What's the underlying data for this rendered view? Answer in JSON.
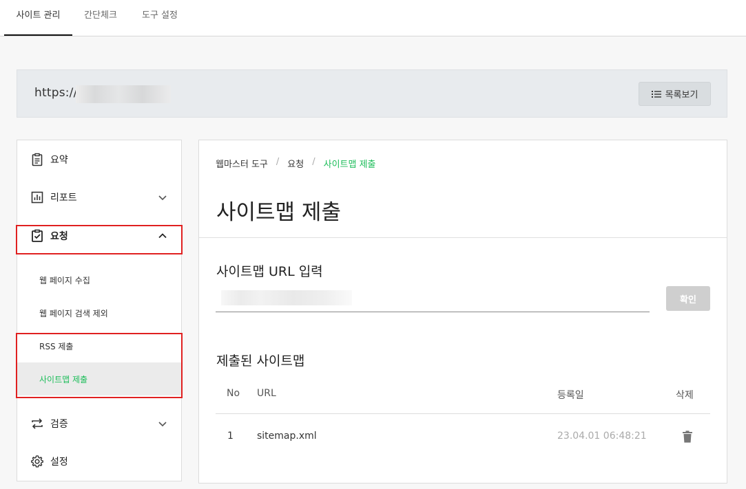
{
  "tabs": [
    {
      "label": "사이트 관리",
      "active": true
    },
    {
      "label": "간단체크",
      "active": false
    },
    {
      "label": "도구 설정",
      "active": false
    }
  ],
  "site": {
    "url_prefix": "https://",
    "list_button": "목록보기"
  },
  "sidebar": {
    "summary": "요약",
    "report": "리포트",
    "request": "요청",
    "request_sub": [
      "웹 페이지 수집",
      "웹 페이지 검색 제외",
      "RSS 제출",
      "사이트맵 제출"
    ],
    "verify": "검증",
    "settings": "설정"
  },
  "breadcrumb": [
    "웹마스터 도구",
    "요청",
    "사이트맵 제출"
  ],
  "page_title": "사이트맵 제출",
  "sitemap_input": {
    "label": "사이트맵 URL 입력",
    "placeholder": "",
    "button": "확인"
  },
  "submitted": {
    "label": "제출된 사이트맵",
    "headers": {
      "no": "No",
      "url": "URL",
      "date": "등록일",
      "delete": "삭제"
    },
    "rows": [
      {
        "no": "1",
        "url": "sitemap.xml",
        "date": "23.04.01 06:48:21"
      }
    ]
  },
  "colors": {
    "accent_green": "#1dbd5a",
    "highlight_red": "#e02020"
  }
}
